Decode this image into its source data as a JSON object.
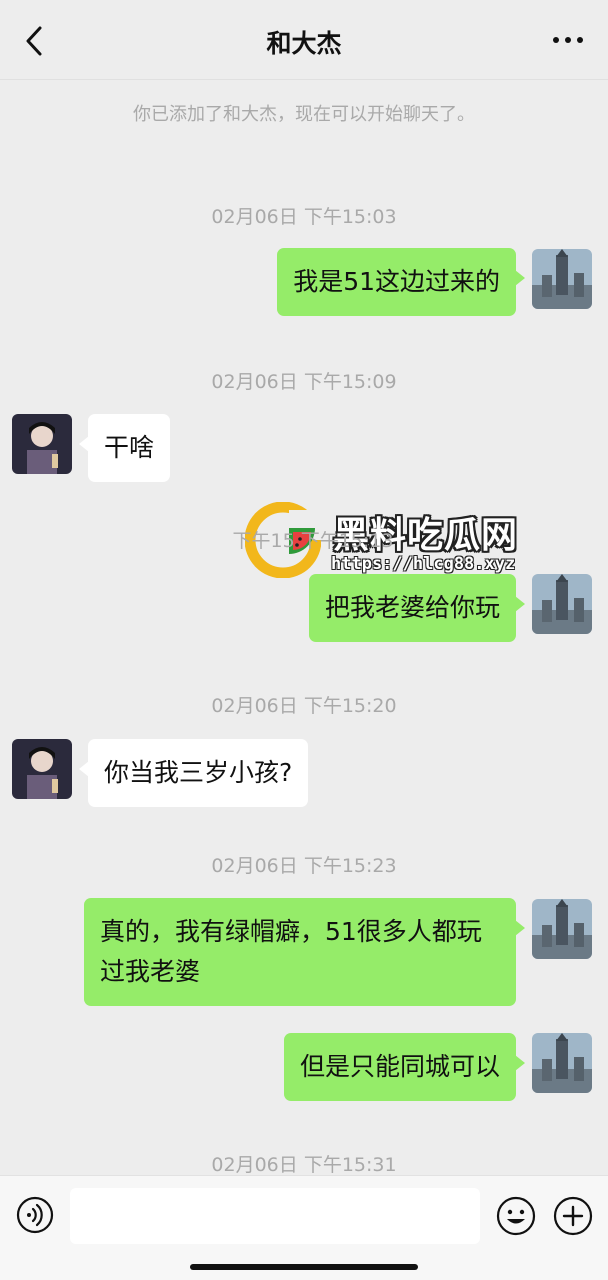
{
  "header": {
    "title": "和大杰"
  },
  "chat": {
    "system_notice": "你已添加了和大杰，现在可以开始聊天了。",
    "timestamps": [
      "02月06日 下午15:03",
      "02月06日 下午15:09",
      "下午15 下午15:13",
      "02月06日 下午15:20",
      "02月06日 下午15:23",
      "02月06日 下午15:31"
    ],
    "messages": [
      {
        "from": "me",
        "text": "我是51这边过来的"
      },
      {
        "from": "other",
        "text": "干啥"
      },
      {
        "from": "me",
        "text": "把我老婆给你玩"
      },
      {
        "from": "other",
        "text": "你当我三岁小孩?"
      },
      {
        "from": "me",
        "text": "真的，我有绿帽癖，51很多人都玩过我老婆"
      },
      {
        "from": "me",
        "text": "但是只能同城可以"
      }
    ]
  },
  "watermark": {
    "title": "黑料吃瓜网",
    "url": "https://hlcg88.xyz"
  },
  "input": {
    "placeholder": ""
  },
  "colors": {
    "my_bubble": "#95ec69",
    "other_bubble": "#ffffff",
    "background": "#ededed"
  },
  "icons": {
    "back": "chevron-left-icon",
    "more": "ellipsis-icon",
    "voice": "voice-icon",
    "emoji": "emoji-icon",
    "plus": "plus-icon"
  }
}
